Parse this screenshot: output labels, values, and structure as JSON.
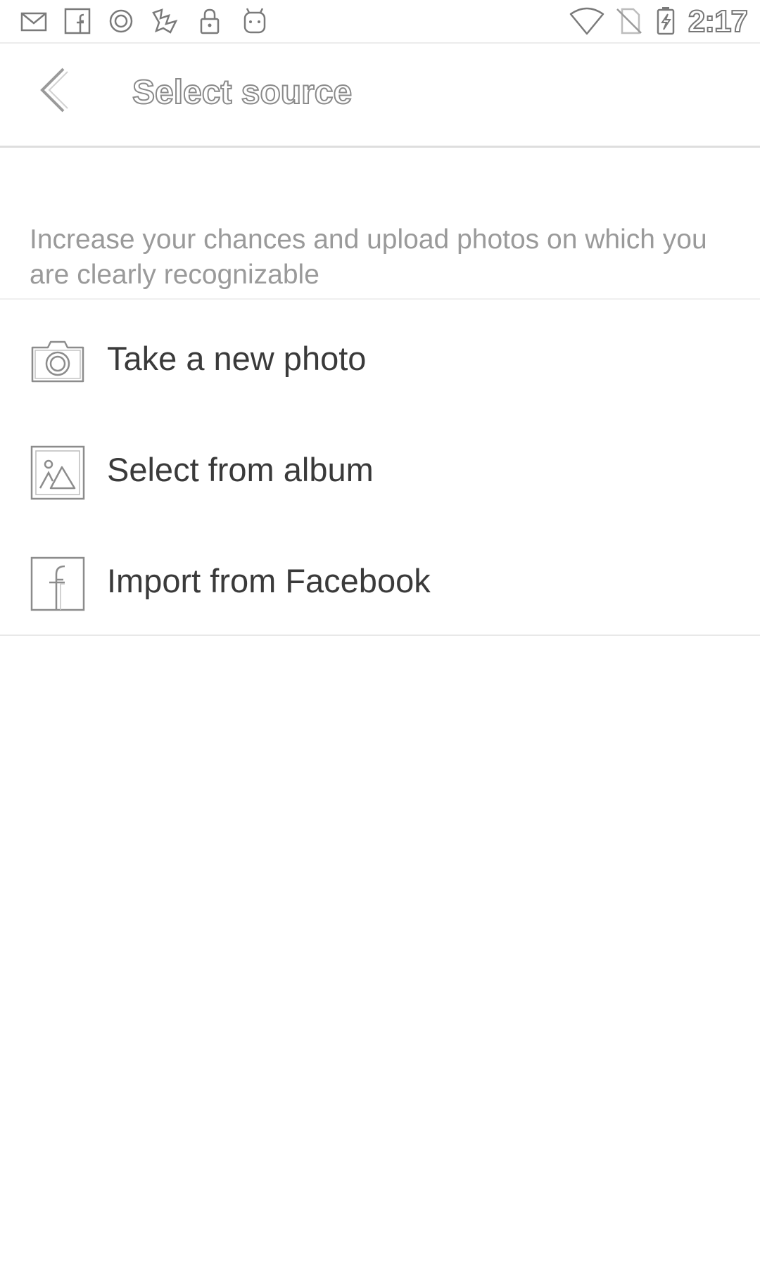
{
  "status_bar": {
    "time": "2:17",
    "left_icons": [
      "mail-icon",
      "facebook-icon",
      "circle-o-icon",
      "app-icon",
      "lock-icon",
      "android-icon"
    ],
    "right_icons": [
      "wifi-icon",
      "no-sim-icon",
      "battery-charging-icon"
    ]
  },
  "toolbar": {
    "title": "Select source",
    "back_icon": "chevron-left-icon"
  },
  "hint": "Increase your chances and upload photos on which you are clearly recognizable",
  "options": [
    {
      "icon": "camera-icon",
      "label": "Take a new photo"
    },
    {
      "icon": "image-icon",
      "label": "Select from album"
    },
    {
      "icon": "facebook-icon",
      "label": "Import from Facebook"
    }
  ],
  "colors": {
    "icon_stroke": "#8c8c8c",
    "text": "#3a3a3a",
    "hint_text": "#9a9a9a",
    "divider": "#e8e8e8"
  }
}
